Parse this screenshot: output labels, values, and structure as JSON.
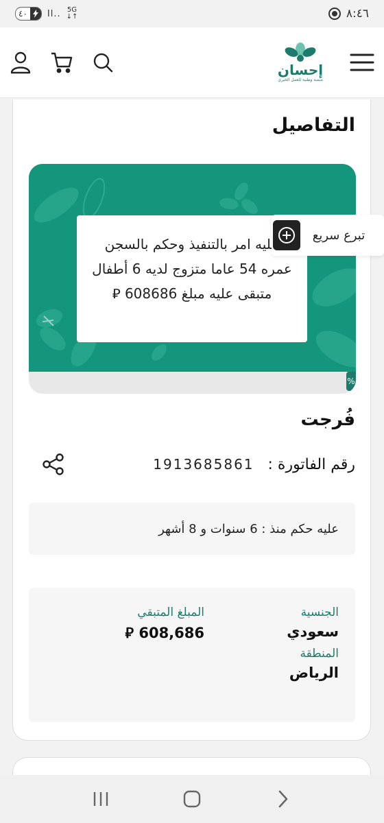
{
  "status_bar": {
    "time": "٨:٤٦",
    "battery": "٤٠",
    "network": "5G",
    "signal": "Il.."
  },
  "header": {
    "logo_text": "إحسان",
    "logo_subtitle": "منصة وطنية للعمل الخيري"
  },
  "details": {
    "title": "التفاصيل"
  },
  "banner": {
    "description": "عليه امر بالتنفيذ وحكم بالسجن عمره 54 عاما متزوج لديه 6 أطفال متبقى عليه مبلغ 608686 ⃁",
    "percent": "%"
  },
  "quick_donate": {
    "label": "تبرع سريع"
  },
  "case": {
    "title": "فُرجت",
    "invoice_label": "رقم الفاتورة :",
    "invoice_number": "1913685861",
    "sentence_info": "عليه حكم منذ : 6 سنوات و 8 أشهر"
  },
  "info": {
    "nationality_label": "الجنسية",
    "nationality_value": "سعودي",
    "remaining_label": "المبلغ المتبقي",
    "remaining_value": "608,686 ⃁",
    "region_label": "المنطقة",
    "region_value": "الرياض"
  },
  "colors": {
    "brand_green": "#1e7a6b",
    "banner_green": "#14967c"
  },
  "icons": {
    "menu": "hamburger-icon",
    "cart": "cart-icon",
    "search": "search-icon",
    "user": "user-icon",
    "share": "share-icon",
    "plus": "plus-circle-icon"
  }
}
